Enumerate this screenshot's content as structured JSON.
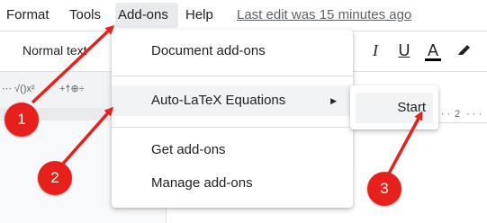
{
  "menubar": {
    "items": [
      "Format",
      "Tools",
      "Add-ons",
      "Help"
    ],
    "last_edit": "Last edit was 15 minutes ago"
  },
  "toolbar": {
    "style_select": "Normal text",
    "italic": "I",
    "underline": "U",
    "text_color": "A"
  },
  "dropdown": {
    "items": [
      "Document add-ons",
      "Auto-LaTeX Equations",
      "Get add-ons",
      "Manage add-ons"
    ]
  },
  "submenu": {
    "start": "Start"
  },
  "ruler": {
    "tick": "2"
  },
  "callouts": [
    "1",
    "2",
    "3"
  ],
  "colors": {
    "accent": "#e8201c",
    "menu_active_bg": "#e8eaed",
    "highlight_bg": "#f1f3f4"
  }
}
